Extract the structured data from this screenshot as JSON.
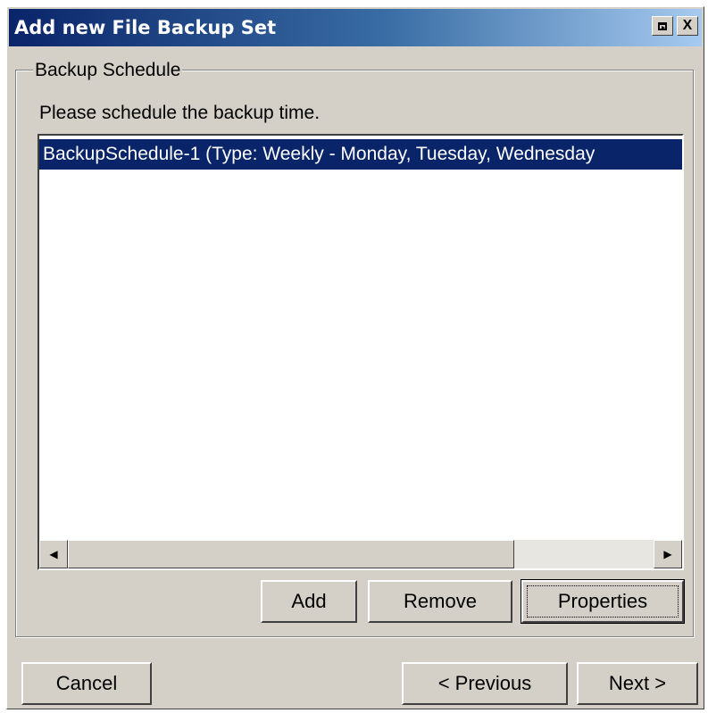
{
  "window": {
    "title": "Add new File Backup Set"
  },
  "titlebar_buttons": {
    "restore_icon": "restore-icon",
    "close_label": "X"
  },
  "backup_schedule": {
    "group_label": "Backup Schedule",
    "prompt": "Please schedule the backup time.",
    "items": [
      {
        "label": "BackupSchedule-1 (Type: Weekly - Monday, Tuesday, Wednesday",
        "selected": true
      }
    ],
    "selection_color": "#0a246a"
  },
  "scrollbar": {
    "left_arrow": "◀",
    "right_arrow": "▶"
  },
  "schedule_buttons": {
    "add": "Add",
    "remove": "Remove",
    "properties": "Properties"
  },
  "nav_buttons": {
    "cancel": "Cancel",
    "previous": "< Previous",
    "next": "Next >"
  }
}
